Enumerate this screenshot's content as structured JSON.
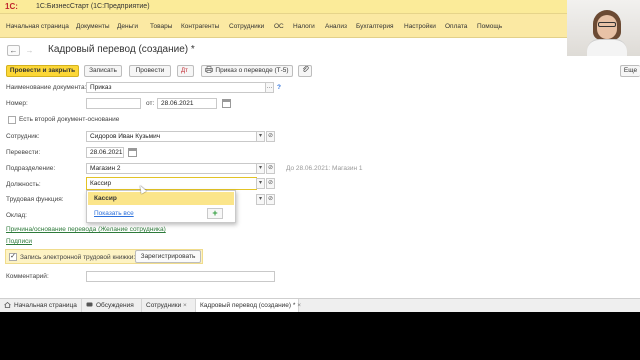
{
  "app": {
    "logo": "1С:",
    "title": "1С:БизнесСтарт  (1С:Предприятие)"
  },
  "menu": [
    "Начальная страница",
    "Документы",
    "Деньги",
    "Товары",
    "Контрагенты",
    "Сотрудники",
    "ОС",
    "Налоги",
    "Анализ",
    "Бухгалтерия",
    "Настройки",
    "Оплата",
    "Помощь"
  ],
  "document": {
    "title": "Кадровый перевод (создание) *",
    "back_icon": "←",
    "forward_icon": "→"
  },
  "toolbar": {
    "post_close": "Провести и закрыть",
    "save": "Записать",
    "post": "Провести",
    "print_order": "Приказ о переводе (Т-5)",
    "more": "Еще"
  },
  "form": {
    "doc_name_label": "Наименование документа:",
    "doc_name_value": "Приказ",
    "number_label": "Номер:",
    "number_value": "",
    "date_label": "от:",
    "date_value": "28.06.2021",
    "second_doc_label": "Есть второй документ-основание",
    "employee_label": "Сотрудник:",
    "employee_value": "Сидоров Иван Кузьмич",
    "transfer_label": "Перевести:",
    "transfer_value": "28.06.2021",
    "department_label": "Подразделение:",
    "department_value": "Магазин 2",
    "department_hint": "До 28.06.2021: Магазин 1",
    "position_label": "Должность:",
    "position_value": "Кассир",
    "function_label": "Трудовая функция:",
    "salary_label": "Оклад:",
    "reason_link": "Причина/основание перевода (Желание сотрудника)",
    "signatures_link": "Подписи",
    "etk_label": "Запись электронной трудовой книжки:",
    "etk_checked": "✓",
    "register_button": "Зарегистрировать",
    "comment_label": "Комментарий:",
    "help_mark": "?",
    "select_glyph": "…",
    "open_glyph": "⊘",
    "dropdown_glyph": "▾"
  },
  "dropdown": {
    "selected": "Кассир",
    "show_all": "Показать все",
    "add_icon": "+"
  },
  "tabs": [
    {
      "label": "Начальная страница",
      "icon": "home-icon"
    },
    {
      "label": "Обсуждения",
      "icon": "chat-icon"
    },
    {
      "label": "Сотрудники",
      "close": "×"
    },
    {
      "label": "Кадровый перевод (создание) *",
      "close": "×"
    }
  ],
  "colors": {
    "menu_bg": "#fbe9a3",
    "primary_button": "#fcd737",
    "link": "#2d7a3a",
    "accent": "#2a6fdb"
  }
}
